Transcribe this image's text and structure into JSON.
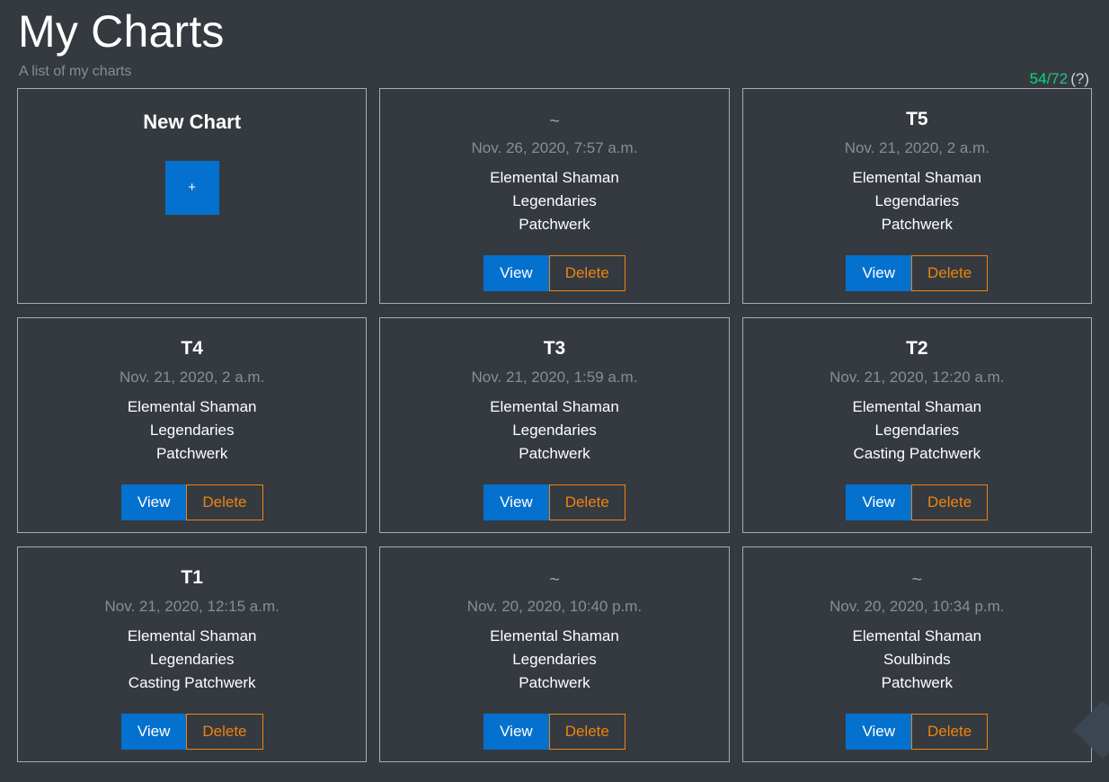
{
  "header": {
    "title": "My Charts",
    "subtitle": "A list of my charts",
    "counter": {
      "used": "54",
      "separator": "/",
      "total": "72",
      "help": "(?)"
    }
  },
  "new_chart_card": {
    "title": "New Chart",
    "add_button_label": "+",
    "add_button_icon": "plus-icon"
  },
  "actions": {
    "view_label": "View",
    "delete_label": "Delete"
  },
  "colors": {
    "background": "#343a40",
    "card_border": "#a5acb3",
    "primary_blue": "#0571cf",
    "danger_orange": "#f0830e",
    "muted_text": "#868e96",
    "counter_green": "#00e07b"
  },
  "cards": [
    {
      "title": "~",
      "is_tilde": true,
      "date": "Nov. 26, 2020, 7:57 a.m.",
      "lines": [
        "Elemental Shaman",
        "Legendaries",
        "Patchwerk"
      ]
    },
    {
      "title": "T5",
      "is_tilde": false,
      "date": "Nov. 21, 2020, 2 a.m.",
      "lines": [
        "Elemental Shaman",
        "Legendaries",
        "Patchwerk"
      ]
    },
    {
      "title": "T4",
      "is_tilde": false,
      "date": "Nov. 21, 2020, 2 a.m.",
      "lines": [
        "Elemental Shaman",
        "Legendaries",
        "Patchwerk"
      ]
    },
    {
      "title": "T3",
      "is_tilde": false,
      "date": "Nov. 21, 2020, 1:59 a.m.",
      "lines": [
        "Elemental Shaman",
        "Legendaries",
        "Patchwerk"
      ]
    },
    {
      "title": "T2",
      "is_tilde": false,
      "date": "Nov. 21, 2020, 12:20 a.m.",
      "lines": [
        "Elemental Shaman",
        "Legendaries",
        "Casting Patchwerk"
      ]
    },
    {
      "title": "T1",
      "is_tilde": false,
      "date": "Nov. 21, 2020, 12:15 a.m.",
      "lines": [
        "Elemental Shaman",
        "Legendaries",
        "Casting Patchwerk"
      ]
    },
    {
      "title": "~",
      "is_tilde": true,
      "date": "Nov. 20, 2020, 10:40 p.m.",
      "lines": [
        "Elemental Shaman",
        "Legendaries",
        "Patchwerk"
      ]
    },
    {
      "title": "~",
      "is_tilde": true,
      "date": "Nov. 20, 2020, 10:34 p.m.",
      "lines": [
        "Elemental Shaman",
        "Soulbinds",
        "Patchwerk"
      ]
    }
  ]
}
